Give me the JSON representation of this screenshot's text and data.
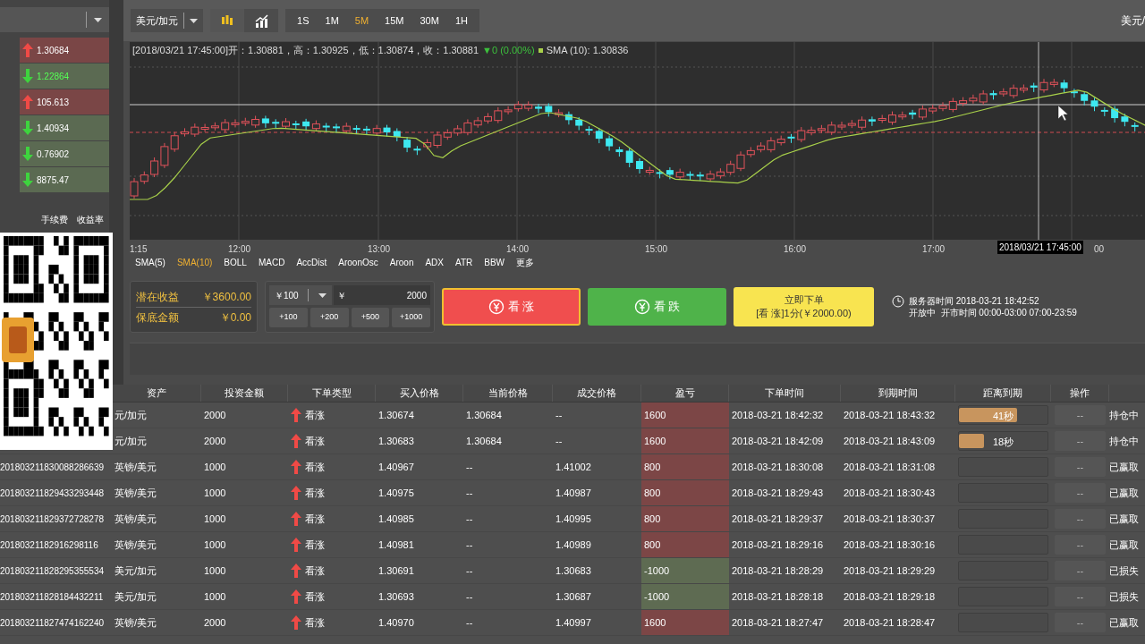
{
  "quotes": [
    {
      "rising": true,
      "value": "1.30684",
      "highlighted": false
    },
    {
      "rising": false,
      "value": "1.22864",
      "highlighted": true
    },
    {
      "rising": true,
      "value": "105.613",
      "highlighted": false
    },
    {
      "rising": false,
      "value": "1.40934",
      "highlighted": false
    },
    {
      "rising": false,
      "value": "0.76902",
      "highlighted": false
    },
    {
      "rising": false,
      "value": "8875.47",
      "highlighted": false
    }
  ],
  "quote_headers": [
    "手续费",
    "收益率"
  ],
  "toolbar": {
    "pair": "美元/加元",
    "chart_types": [
      {
        "kind": "candles",
        "selected": true
      },
      {
        "kind": "line",
        "selected": false
      }
    ],
    "timeframes": [
      {
        "label": "1S",
        "selected": false
      },
      {
        "label": "1M",
        "selected": false
      },
      {
        "label": "5M",
        "selected": true
      },
      {
        "label": "15M",
        "selected": false
      },
      {
        "label": "30M",
        "selected": false
      },
      {
        "label": "1H",
        "selected": false
      }
    ],
    "right_label": "美元/"
  },
  "chart": {
    "ohlc": "[2018/03/21 17:45:00]开：1.30881，高：1.30925，低：1.30874，收：1.30881",
    "change": "▼0 (0.00%)",
    "sma": "SMA (10): 1.30836",
    "time_labels": [
      "1:15",
      "12:00",
      "13:00",
      "14:00",
      "15:00",
      "16:00",
      "17:00"
    ],
    "crosshair_label": "2018/03/21 17:45:00",
    "cut_label": "00"
  },
  "indicators": [
    {
      "label": "SMA(5)",
      "selected": false
    },
    {
      "label": "SMA(10)",
      "selected": true
    },
    {
      "label": "BOLL",
      "selected": false
    },
    {
      "label": "MACD",
      "selected": false
    },
    {
      "label": "AccDist",
      "selected": false
    },
    {
      "label": "AroonOsc",
      "selected": false
    },
    {
      "label": "Aroon",
      "selected": false
    },
    {
      "label": "ADX",
      "selected": false
    },
    {
      "label": "ATR",
      "selected": false
    },
    {
      "label": "BBW",
      "selected": false
    },
    {
      "label": "更多",
      "selected": false
    }
  ],
  "summary": [
    {
      "label": "潜在收益",
      "value": "￥3600.00"
    },
    {
      "label": "保底金额",
      "value": "￥0.00"
    }
  ],
  "order": {
    "preset": "￥100",
    "currency": "￥",
    "amount": "2000",
    "increments": [
      "+100",
      "+200",
      "+500",
      "+1000"
    ],
    "buttons": [
      {
        "kind": "up",
        "label": "看 涨"
      },
      {
        "kind": "down",
        "label": "看 跌"
      }
    ],
    "submit": {
      "title": "立即下单",
      "detail": "[看 涨]1分(￥2000.00)"
    }
  },
  "server": {
    "time": "服务器时间 2018-03-21 18:42:52",
    "status": "开放中  开市时间 00:00-03:00 07:00-23:59"
  },
  "table": {
    "columns": [
      "资产",
      "投资金额",
      "下单类型",
      "买入价格",
      "当前价格",
      "成交价格",
      "盈亏",
      "下单时间",
      "到期时间",
      "距离到期",
      "操作"
    ],
    "rows": [
      {
        "asset": "元/加元",
        "amount": "2000",
        "rising": true,
        "type": "看涨",
        "buy": "1.30674",
        "current": "1.30684",
        "deal": "--",
        "pnl": "1600",
        "profit": true,
        "placed": "2018-03-21 18:42:32",
        "expiry": "2018-03-21 18:43:32",
        "countdown": {
          "level": 0.66,
          "label": "41秒"
        },
        "action": "--",
        "status": "持仓中"
      },
      {
        "asset": "元/加元",
        "amount": "2000",
        "rising": true,
        "type": "看涨",
        "buy": "1.30683",
        "current": "1.30684",
        "deal": "--",
        "pnl": "1600",
        "profit": true,
        "placed": "2018-03-21 18:42:09",
        "expiry": "2018-03-21 18:43:09",
        "countdown": {
          "level": 0.28,
          "label": "18秒"
        },
        "action": "--",
        "status": "持仓中"
      },
      {
        "order_id": "201803211830088286639",
        "asset": "英镑/美元",
        "amount": "1000",
        "rising": true,
        "type": "看涨",
        "buy": "1.40967",
        "current": "--",
        "deal": "1.41002",
        "pnl": "800",
        "profit": true,
        "placed": "2018-03-21 18:30:08",
        "expiry": "2018-03-21 18:31:08",
        "action": "--",
        "status": "已赢取"
      },
      {
        "order_id": "201803211829433293448",
        "asset": "英镑/美元",
        "amount": "1000",
        "rising": true,
        "type": "看涨",
        "buy": "1.40975",
        "current": "--",
        "deal": "1.40987",
        "pnl": "800",
        "profit": true,
        "placed": "2018-03-21 18:29:43",
        "expiry": "2018-03-21 18:30:43",
        "action": "--",
        "status": "已赢取"
      },
      {
        "order_id": "201803211829372728278",
        "asset": "英镑/美元",
        "amount": "1000",
        "rising": true,
        "type": "看涨",
        "buy": "1.40985",
        "current": "--",
        "deal": "1.40995",
        "pnl": "800",
        "profit": true,
        "placed": "2018-03-21 18:29:37",
        "expiry": "2018-03-21 18:30:37",
        "action": "--",
        "status": "已赢取"
      },
      {
        "order_id": "20180321182916298116",
        "asset": "英镑/美元",
        "amount": "1000",
        "rising": true,
        "type": "看涨",
        "buy": "1.40981",
        "current": "--",
        "deal": "1.40989",
        "pnl": "800",
        "profit": true,
        "placed": "2018-03-21 18:29:16",
        "expiry": "2018-03-21 18:30:16",
        "action": "--",
        "status": "已赢取"
      },
      {
        "order_id": "201803211828295355534",
        "asset": "美元/加元",
        "amount": "1000",
        "rising": true,
        "type": "看涨",
        "buy": "1.30691",
        "current": "--",
        "deal": "1.30683",
        "pnl": "-1000",
        "profit": false,
        "placed": "2018-03-21 18:28:29",
        "expiry": "2018-03-21 18:29:29",
        "action": "--",
        "status": "已损失"
      },
      {
        "order_id": "201803211828184432211",
        "asset": "美元/加元",
        "amount": "1000",
        "rising": true,
        "type": "看涨",
        "buy": "1.30693",
        "current": "--",
        "deal": "1.30687",
        "pnl": "-1000",
        "profit": false,
        "placed": "2018-03-21 18:28:18",
        "expiry": "2018-03-21 18:29:18",
        "action": "--",
        "status": "已损失"
      },
      {
        "order_id": "201803211827474162240",
        "asset": "英镑/美元",
        "amount": "2000",
        "rising": true,
        "type": "看涨",
        "buy": "1.40970",
        "current": "--",
        "deal": "1.40997",
        "pnl": "1600",
        "profit": true,
        "placed": "2018-03-21 18:27:47",
        "expiry": "2018-03-21 18:28:47",
        "action": "--",
        "status": "已赢取"
      }
    ]
  }
}
